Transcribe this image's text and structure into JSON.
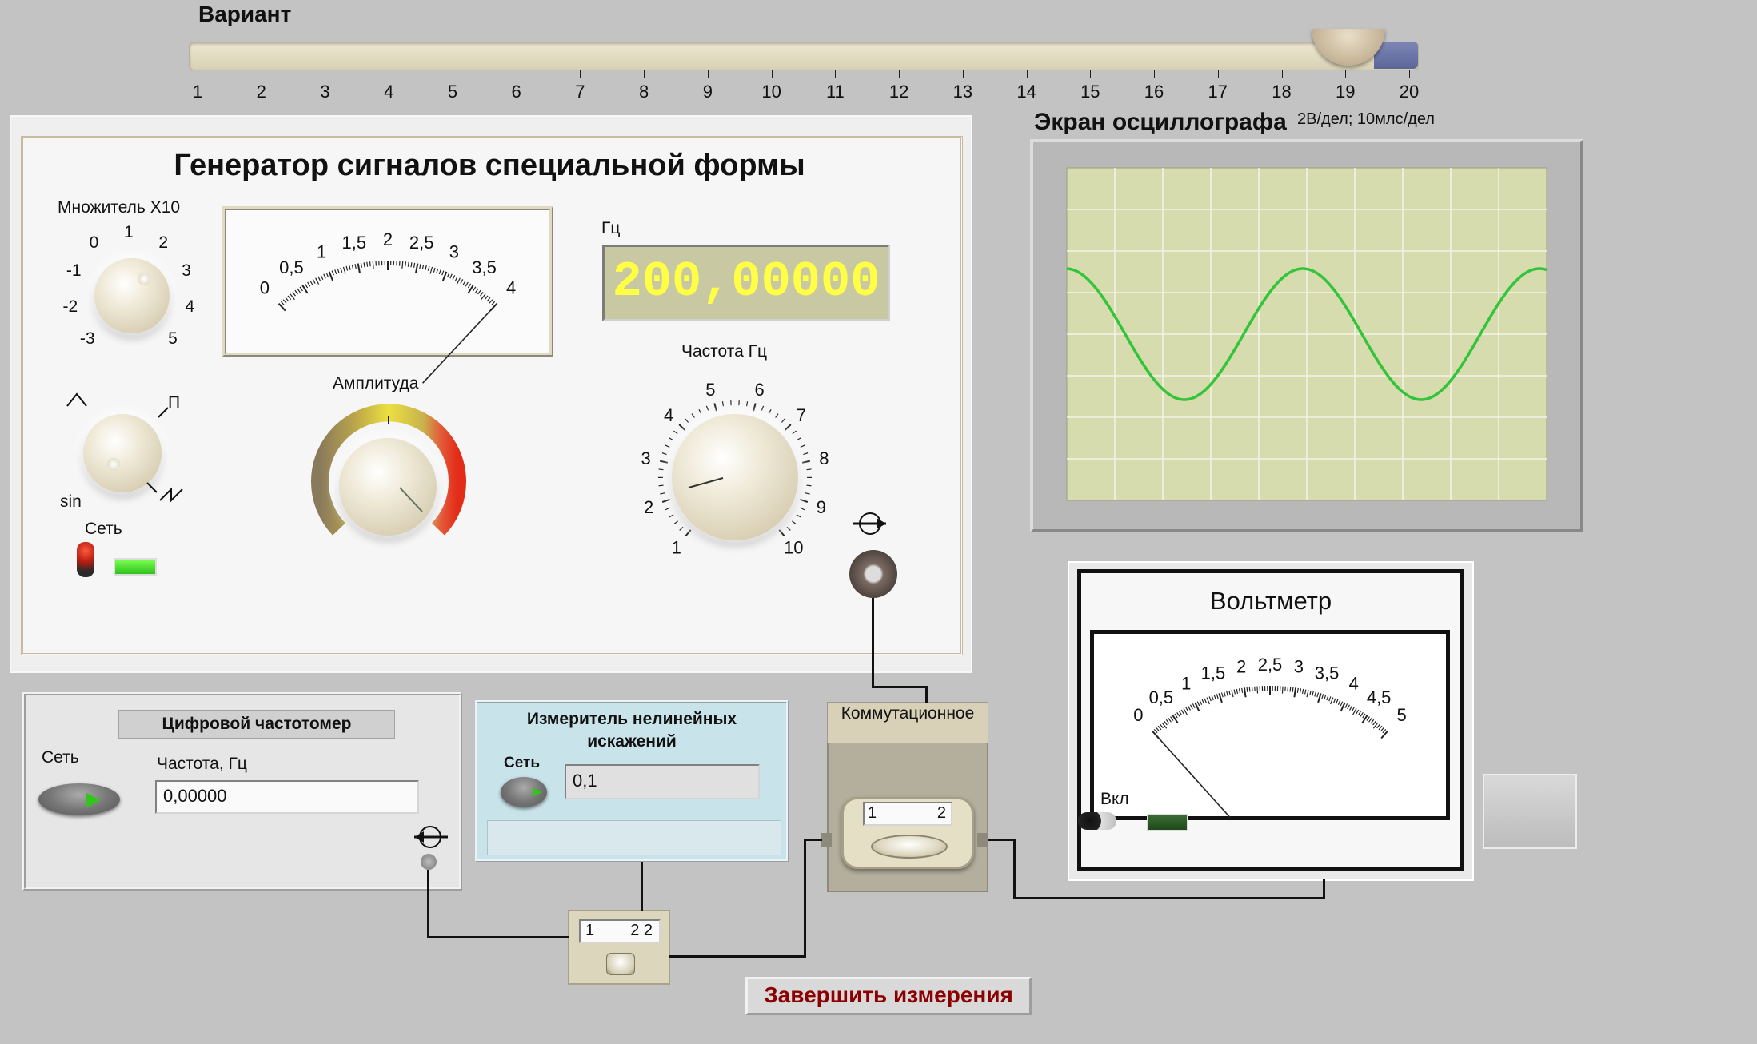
{
  "variant": {
    "title": "Вариант",
    "ticks": [
      "1",
      "2",
      "3",
      "4",
      "5",
      "6",
      "7",
      "8",
      "9",
      "10",
      "11",
      "12",
      "13",
      "14",
      "15",
      "16",
      "17",
      "18",
      "19",
      "20"
    ],
    "value": 19
  },
  "generator": {
    "title": "Генератор сигналов специальной формы",
    "multiplier_label": "Множитель X10",
    "multiplier_ticks": [
      "-3",
      "-2",
      "-1",
      "0",
      "1",
      "2",
      "3",
      "4",
      "5"
    ],
    "amplitude_meter_ticks": [
      "0",
      "0,5",
      "1",
      "1,5",
      "2",
      "2,5",
      "3",
      "3,5",
      "4"
    ],
    "amplitude_label": "Амплитуда",
    "waveform_labels": [
      "sin",
      "П"
    ],
    "power_label": "Сеть",
    "freq_unit": "Гц",
    "freq_value": "200,00000",
    "freq_knob_label": "Частота Гц",
    "freq_knob_ticks": [
      "1",
      "2",
      "3",
      "4",
      "5",
      "6",
      "7",
      "8",
      "9",
      "10"
    ]
  },
  "oscilloscope": {
    "title": "Экран осциллографа",
    "scale": "2В/дел; 10млс/дел"
  },
  "voltmeter": {
    "title": "Вольтметр",
    "ticks": [
      "0",
      "0,5",
      "1",
      "1,5",
      "2",
      "2,5",
      "3",
      "3,5",
      "4",
      "4,5",
      "5"
    ],
    "on_label": "Вкл"
  },
  "frequency_counter": {
    "title": "Цифровой частотомер",
    "power_label": "Сеть",
    "freq_label": "Частота, Гц",
    "freq_value": "0,00000"
  },
  "distortion_meter": {
    "title": "Измеритель нелинейных искажений",
    "power_label": "Сеть",
    "value": "0,1"
  },
  "commutation": {
    "title": "Коммутационное",
    "pos1": "1",
    "pos2": "2"
  },
  "small_switch": {
    "pos1": "1",
    "pos2": "2 2"
  },
  "finish_button": {
    "label": "Завершить измерения"
  },
  "colors": {
    "background": "#c3c3c3",
    "display_text": "#ffff45",
    "display_bg": "#c8c9a3",
    "wave": "#33c43a",
    "scope_bg": "#d6dcae",
    "finish_text": "#8b0000"
  }
}
